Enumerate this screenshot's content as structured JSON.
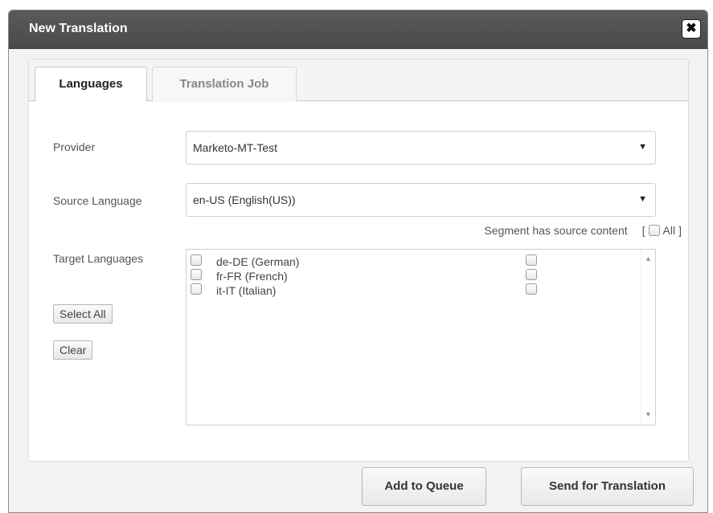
{
  "dialog": {
    "title": "New Translation",
    "close_glyph": "✖"
  },
  "tabs": [
    {
      "label": "Languages",
      "active": true
    },
    {
      "label": "Translation Job",
      "active": false
    }
  ],
  "form": {
    "provider_label": "Provider",
    "provider_value": "Marketo-MT-Test",
    "source_language_label": "Source Language",
    "source_language_value": "en-US  (English(US))",
    "dropdown_arrow": "▼",
    "target_languages_label": "Target Languages",
    "segment_label": "Segment has source content",
    "segment_bracket_open": "[",
    "segment_all_label": "All",
    "segment_bracket_close": "]",
    "select_all_label": "Select All",
    "clear_label": "Clear"
  },
  "target_languages": [
    {
      "label": "de-DE  (German)",
      "checked": false,
      "segment_checked": false
    },
    {
      "label": "fr-FR  (French)",
      "checked": false,
      "segment_checked": false
    },
    {
      "label": "it-IT  (Italian)",
      "checked": false,
      "segment_checked": false
    }
  ],
  "scroll": {
    "up": "▲",
    "down": "▼"
  },
  "footer": {
    "add_to_queue_label": "Add to Queue",
    "send_for_translation_label": "Send for Translation"
  }
}
